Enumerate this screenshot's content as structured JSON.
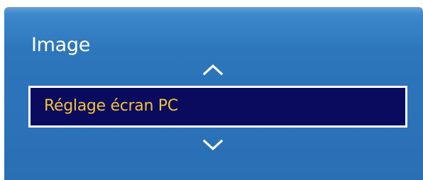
{
  "menu": {
    "title": "Image",
    "selected_item": "Réglage écran PC",
    "up_icon": "chevron-up-icon",
    "down_icon": "chevron-down-icon"
  },
  "colors": {
    "panel_top": "#3f8ccf",
    "panel_bottom": "#2a6fb4",
    "selection_bg": "#0a0a5e",
    "selection_border": "#ffffff",
    "selection_text": "#f0c23c",
    "title_text": "#ffffff"
  }
}
